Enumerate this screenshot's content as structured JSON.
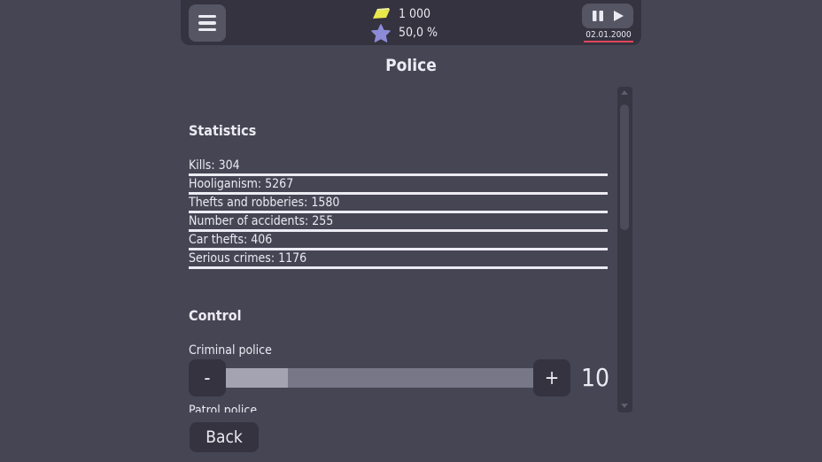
{
  "topbar": {
    "money": "1 000",
    "rating": "50,0 %",
    "date": "02.01.2000",
    "icons": {
      "menu": "hamburger-menu-icon",
      "money": "gold-bar-icon",
      "rating": "star-icon",
      "pause": "pause-icon",
      "play": "play-icon"
    },
    "colors": {
      "money_icon": "#e8e84a",
      "rating_icon": "#8c8bd8",
      "date_underline": "#e0455a"
    }
  },
  "page": {
    "title": "Police"
  },
  "statistics": {
    "heading": "Statistics",
    "rows": [
      "Kills: 304",
      "Hooliganism: 5267",
      "Thefts and robberies: 1580",
      "Number of accidents: 255",
      "Car thefts: 406",
      "Serious crimes: 1176"
    ]
  },
  "control": {
    "heading": "Control",
    "criminal_police": {
      "label": "Criminal police",
      "minus_label": "-",
      "plus_label": "+",
      "value": "10",
      "fill_fraction": 0.2
    },
    "patrol_police": {
      "label": "Patrol police"
    }
  },
  "footer": {
    "back_label": "Back"
  }
}
